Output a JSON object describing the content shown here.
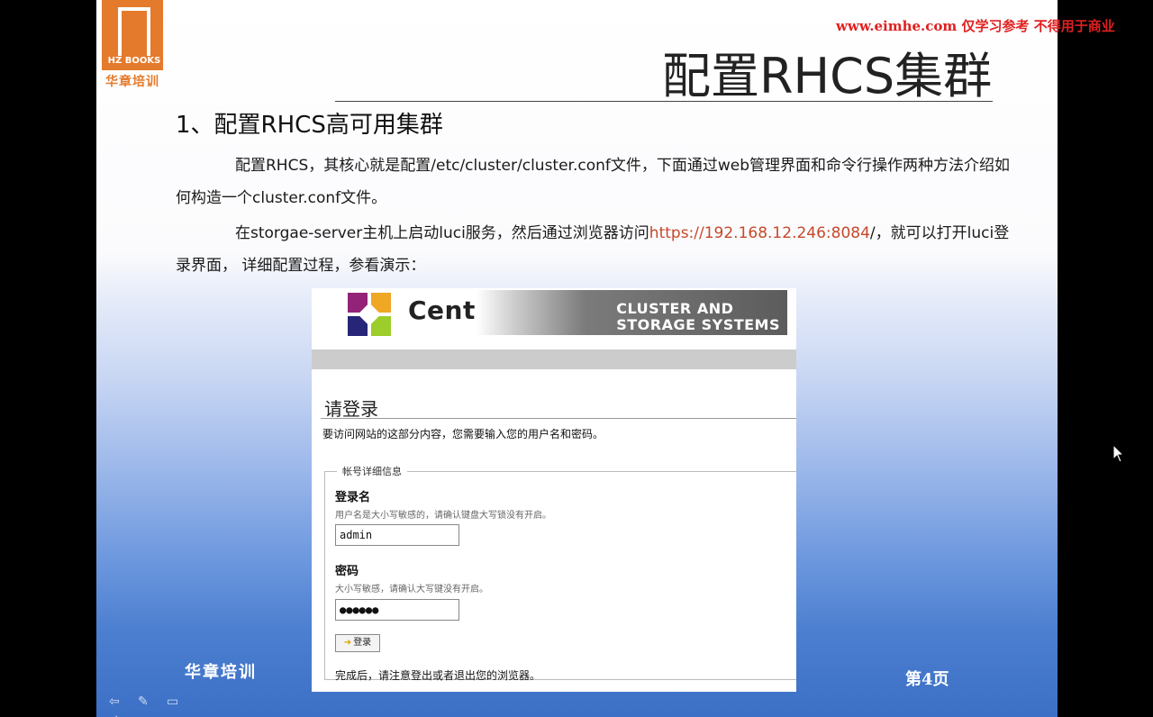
{
  "logo": {
    "text": "HZ BOOKS",
    "cn": "华章培训"
  },
  "watermark": "www.eimhe.com 仅学习参考 不得用于商业",
  "slide": {
    "title": "配置RHCS集群",
    "heading": "1、配置RHCS高可用集群",
    "para1": "配置RHCS，其核心就是配置/etc/cluster/cluster.conf文件，下面通过web管理界面和命令行操作两种方法介绍如何构造一个cluster.conf文件。",
    "para2_a": "在storgae-server主机上启动luci服务，然后通过浏览器访问",
    "para2_link": "https://192.168.12.246:8084",
    "para2_b": "/，就可以打开luci登录界面， 详细配置过程，参看演示：",
    "footer_brand": "华章培训",
    "page_num": "第4页"
  },
  "screenshot": {
    "centos": "CentOS",
    "cluster_line1": "CLUSTER AND",
    "cluster_line2": "STORAGE SYSTEMS",
    "login_title": "请登录",
    "login_desc": "要访问网站的这部分内容，您需要输入您的用户名和密码。",
    "legend": "帐号详细信息",
    "username_label": "登录名",
    "username_help": "用户名是大小写敏感的，请确认键盘大写锁没有开启。",
    "username_value": "admin",
    "password_label": "密码",
    "password_help": "大小写敏感，请确认大写键没有开启。",
    "password_value": "●●●●●●",
    "login_button": "登录",
    "done_text": "完成后，请注意登出或者退出您的浏览器。"
  },
  "colors": {
    "link": "#c6482a",
    "watermark": "#e02020",
    "logo": "#e47a2c"
  },
  "icons": [
    "prev-arrow-icon",
    "pen-icon",
    "screen-icon",
    "next-arrow-icon",
    "mouse-cursor-icon"
  ]
}
